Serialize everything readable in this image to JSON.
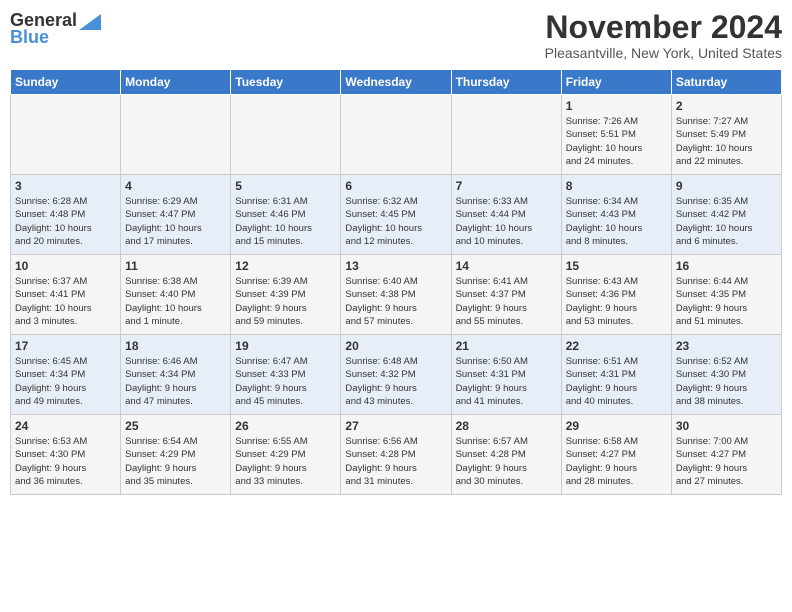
{
  "header": {
    "logo_general": "General",
    "logo_blue": "Blue",
    "month": "November 2024",
    "location": "Pleasantville, New York, United States"
  },
  "days_of_week": [
    "Sunday",
    "Monday",
    "Tuesday",
    "Wednesday",
    "Thursday",
    "Friday",
    "Saturday"
  ],
  "weeks": [
    [
      {
        "day": "",
        "info": ""
      },
      {
        "day": "",
        "info": ""
      },
      {
        "day": "",
        "info": ""
      },
      {
        "day": "",
        "info": ""
      },
      {
        "day": "",
        "info": ""
      },
      {
        "day": "1",
        "info": "Sunrise: 7:26 AM\nSunset: 5:51 PM\nDaylight: 10 hours\nand 24 minutes."
      },
      {
        "day": "2",
        "info": "Sunrise: 7:27 AM\nSunset: 5:49 PM\nDaylight: 10 hours\nand 22 minutes."
      }
    ],
    [
      {
        "day": "3",
        "info": "Sunrise: 6:28 AM\nSunset: 4:48 PM\nDaylight: 10 hours\nand 20 minutes."
      },
      {
        "day": "4",
        "info": "Sunrise: 6:29 AM\nSunset: 4:47 PM\nDaylight: 10 hours\nand 17 minutes."
      },
      {
        "day": "5",
        "info": "Sunrise: 6:31 AM\nSunset: 4:46 PM\nDaylight: 10 hours\nand 15 minutes."
      },
      {
        "day": "6",
        "info": "Sunrise: 6:32 AM\nSunset: 4:45 PM\nDaylight: 10 hours\nand 12 minutes."
      },
      {
        "day": "7",
        "info": "Sunrise: 6:33 AM\nSunset: 4:44 PM\nDaylight: 10 hours\nand 10 minutes."
      },
      {
        "day": "8",
        "info": "Sunrise: 6:34 AM\nSunset: 4:43 PM\nDaylight: 10 hours\nand 8 minutes."
      },
      {
        "day": "9",
        "info": "Sunrise: 6:35 AM\nSunset: 4:42 PM\nDaylight: 10 hours\nand 6 minutes."
      }
    ],
    [
      {
        "day": "10",
        "info": "Sunrise: 6:37 AM\nSunset: 4:41 PM\nDaylight: 10 hours\nand 3 minutes."
      },
      {
        "day": "11",
        "info": "Sunrise: 6:38 AM\nSunset: 4:40 PM\nDaylight: 10 hours\nand 1 minute."
      },
      {
        "day": "12",
        "info": "Sunrise: 6:39 AM\nSunset: 4:39 PM\nDaylight: 9 hours\nand 59 minutes."
      },
      {
        "day": "13",
        "info": "Sunrise: 6:40 AM\nSunset: 4:38 PM\nDaylight: 9 hours\nand 57 minutes."
      },
      {
        "day": "14",
        "info": "Sunrise: 6:41 AM\nSunset: 4:37 PM\nDaylight: 9 hours\nand 55 minutes."
      },
      {
        "day": "15",
        "info": "Sunrise: 6:43 AM\nSunset: 4:36 PM\nDaylight: 9 hours\nand 53 minutes."
      },
      {
        "day": "16",
        "info": "Sunrise: 6:44 AM\nSunset: 4:35 PM\nDaylight: 9 hours\nand 51 minutes."
      }
    ],
    [
      {
        "day": "17",
        "info": "Sunrise: 6:45 AM\nSunset: 4:34 PM\nDaylight: 9 hours\nand 49 minutes."
      },
      {
        "day": "18",
        "info": "Sunrise: 6:46 AM\nSunset: 4:34 PM\nDaylight: 9 hours\nand 47 minutes."
      },
      {
        "day": "19",
        "info": "Sunrise: 6:47 AM\nSunset: 4:33 PM\nDaylight: 9 hours\nand 45 minutes."
      },
      {
        "day": "20",
        "info": "Sunrise: 6:48 AM\nSunset: 4:32 PM\nDaylight: 9 hours\nand 43 minutes."
      },
      {
        "day": "21",
        "info": "Sunrise: 6:50 AM\nSunset: 4:31 PM\nDaylight: 9 hours\nand 41 minutes."
      },
      {
        "day": "22",
        "info": "Sunrise: 6:51 AM\nSunset: 4:31 PM\nDaylight: 9 hours\nand 40 minutes."
      },
      {
        "day": "23",
        "info": "Sunrise: 6:52 AM\nSunset: 4:30 PM\nDaylight: 9 hours\nand 38 minutes."
      }
    ],
    [
      {
        "day": "24",
        "info": "Sunrise: 6:53 AM\nSunset: 4:30 PM\nDaylight: 9 hours\nand 36 minutes."
      },
      {
        "day": "25",
        "info": "Sunrise: 6:54 AM\nSunset: 4:29 PM\nDaylight: 9 hours\nand 35 minutes."
      },
      {
        "day": "26",
        "info": "Sunrise: 6:55 AM\nSunset: 4:29 PM\nDaylight: 9 hours\nand 33 minutes."
      },
      {
        "day": "27",
        "info": "Sunrise: 6:56 AM\nSunset: 4:28 PM\nDaylight: 9 hours\nand 31 minutes."
      },
      {
        "day": "28",
        "info": "Sunrise: 6:57 AM\nSunset: 4:28 PM\nDaylight: 9 hours\nand 30 minutes."
      },
      {
        "day": "29",
        "info": "Sunrise: 6:58 AM\nSunset: 4:27 PM\nDaylight: 9 hours\nand 28 minutes."
      },
      {
        "day": "30",
        "info": "Sunrise: 7:00 AM\nSunset: 4:27 PM\nDaylight: 9 hours\nand 27 minutes."
      }
    ]
  ]
}
